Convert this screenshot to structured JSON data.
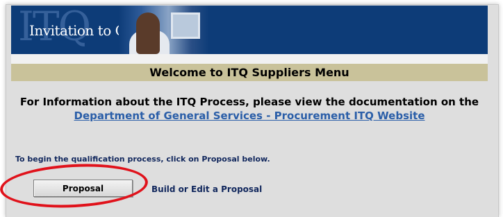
{
  "banner": {
    "title": "Invitation to Qualify",
    "ghost_text": "ITQ"
  },
  "welcome": "Welcome to ITQ Suppliers Menu",
  "info_text": "For Information about the ITQ Process, please view the documentation on the",
  "link_text": "Department of General Services - Procurement ITQ Website",
  "begin_text": "To begin the qualification process, click on Proposal below.",
  "proposal_button": "Proposal",
  "build_text": "Build or Edit a Proposal",
  "colors": {
    "banner": "#0d3c78",
    "welcome_bar": "#c9c29a",
    "link": "#2a5ea8",
    "highlight_circle": "#e0121b"
  }
}
